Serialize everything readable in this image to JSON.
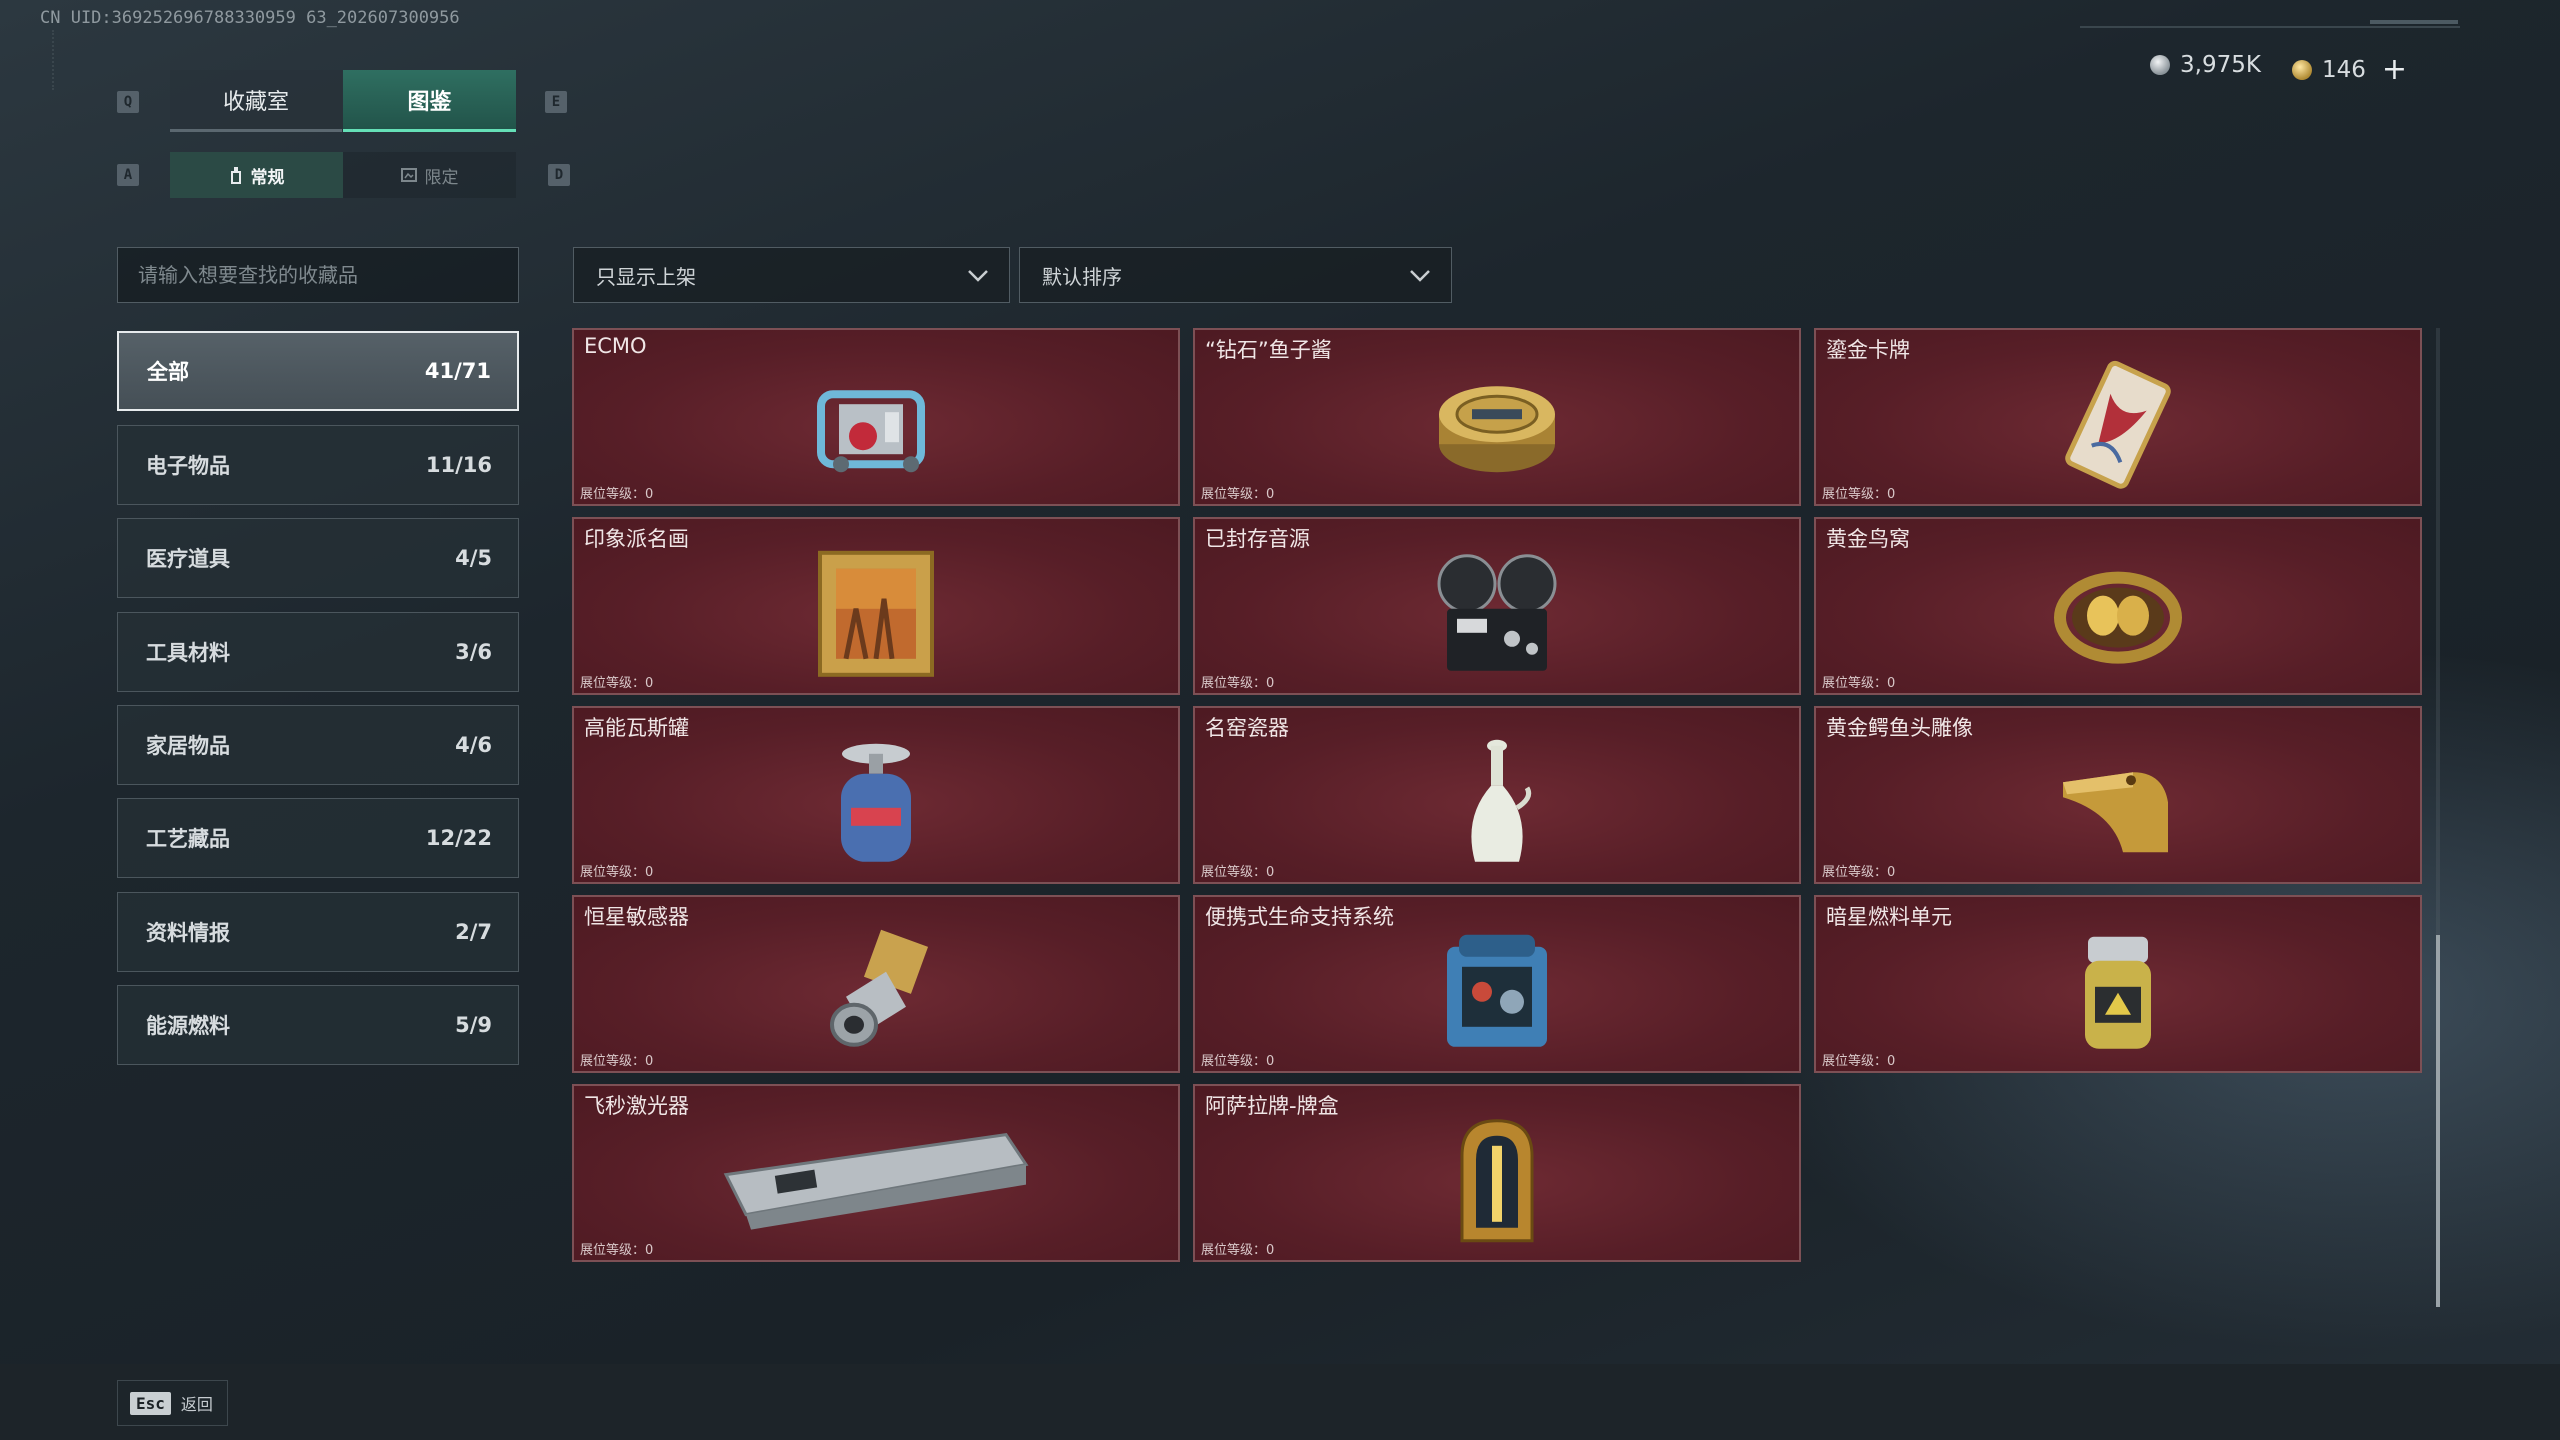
{
  "uid_text": "CN UID:369252696788330959 63_202607300956",
  "currency": {
    "silver": "3,975K",
    "gold": "146",
    "plus": "+"
  },
  "hotkeys": {
    "prev_tab": "Q",
    "next_tab": "E",
    "prev_subtab": "A",
    "next_subtab": "D"
  },
  "tabs": [
    {
      "label": "收藏室",
      "active": false
    },
    {
      "label": "图鉴",
      "active": true
    }
  ],
  "subtabs": [
    {
      "label": "常规",
      "active": true
    },
    {
      "label": "限定",
      "active": false
    }
  ],
  "search": {
    "placeholder": "请输入想要查找的收藏品"
  },
  "filters": {
    "shelf": "只显示上架",
    "sort": "默认排序"
  },
  "categories": [
    {
      "label": "全部",
      "count": "41/71",
      "active": true
    },
    {
      "label": "电子物品",
      "count": "11/16"
    },
    {
      "label": "医疗道具",
      "count": "4/5"
    },
    {
      "label": "工具材料",
      "count": "3/6"
    },
    {
      "label": "家居物品",
      "count": "4/6"
    },
    {
      "label": "工艺藏品",
      "count": "12/22"
    },
    {
      "label": "资料情报",
      "count": "2/7"
    },
    {
      "label": "能源燃料",
      "count": "5/9"
    }
  ],
  "level_label": "展位等级：0",
  "cards": [
    {
      "name": "",
      "icon": "partial-item-icon"
    },
    {
      "name": "",
      "icon": "partial-item-icon"
    },
    {
      "name": "",
      "icon": "partial-item-icon"
    },
    {
      "name": "ECMO",
      "icon": "ecmo-machine-icon"
    },
    {
      "name": "“钻石”鱼子酱",
      "icon": "caviar-tin-icon"
    },
    {
      "name": "鎏金卡牌",
      "icon": "gilded-card-icon"
    },
    {
      "name": "印象派名画",
      "icon": "framed-painting-icon"
    },
    {
      "name": "已封存音源",
      "icon": "reel-recorder-icon"
    },
    {
      "name": "黄金鸟窝",
      "icon": "golden-nest-icon"
    },
    {
      "name": "高能瓦斯罐",
      "icon": "gas-canister-icon"
    },
    {
      "name": "名窑瓷器",
      "icon": "porcelain-vase-icon"
    },
    {
      "name": "黄金鳄鱼头雕像",
      "icon": "gold-crocodile-head-icon"
    },
    {
      "name": "恒星敏感器",
      "icon": "star-sensor-icon"
    },
    {
      "name": "便携式生命支持系统",
      "icon": "life-support-system-icon"
    },
    {
      "name": "暗星燃料单元",
      "icon": "fuel-cell-icon"
    },
    {
      "name": "飞秒激光器",
      "icon": "laser-device-icon"
    },
    {
      "name": "阿萨拉牌-牌盒",
      "icon": "card-box-icon"
    }
  ],
  "footer": {
    "esc_key": "Esc",
    "back_label": "返回"
  },
  "colors": {
    "accent": "#65e0b7",
    "card_bg": "#5a1f28",
    "card_border": "#7d5055"
  }
}
